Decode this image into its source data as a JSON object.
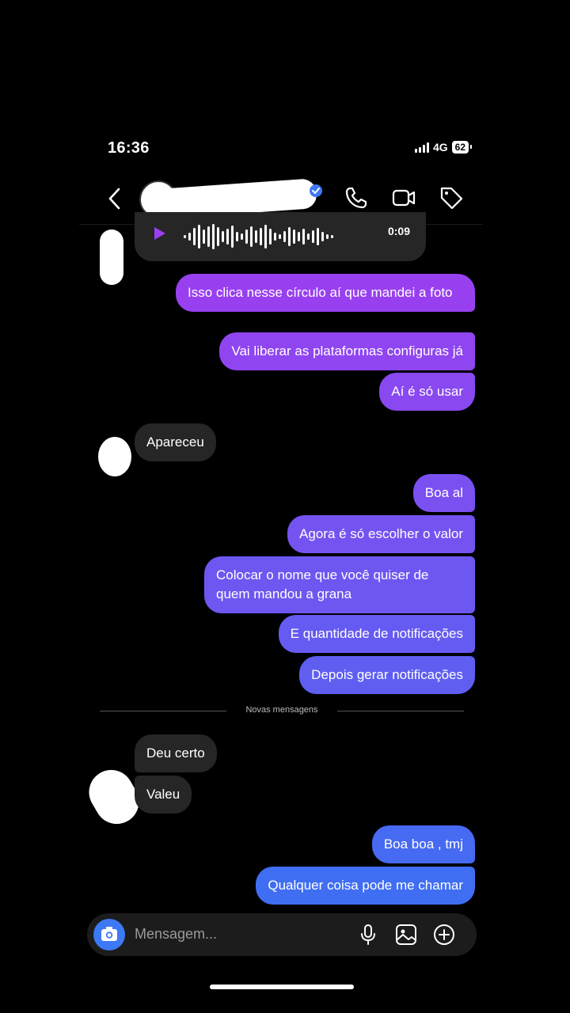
{
  "status_bar": {
    "time": "16:36",
    "network": "4G",
    "battery": "62"
  },
  "composer": {
    "placeholder": "Mensagem..."
  },
  "voice_message": {
    "duration": "0:09"
  },
  "messages": [
    {
      "dir": "out",
      "text": "Isso clica nesse círculo aí que mandei a foto"
    },
    {
      "dir": "out",
      "text": "Vai liberar as plataformas configuras já"
    },
    {
      "dir": "out",
      "text": "Aí é só usar"
    },
    {
      "dir": "in",
      "text": "Apareceu"
    },
    {
      "dir": "out",
      "text": "Boa al"
    },
    {
      "dir": "out",
      "text": "Agora é só escolher o valor"
    },
    {
      "dir": "out",
      "text": "Colocar o nome que você quiser de quem mandou a grana"
    },
    {
      "dir": "out",
      "text": "E quantidade de notificações"
    },
    {
      "dir": "out",
      "text": "Depois gerar notificações"
    },
    {
      "dir": "in",
      "text": "Deu certo"
    },
    {
      "dir": "in",
      "text": "Valeu"
    },
    {
      "dir": "out",
      "text": "Boa boa , tmj"
    },
    {
      "dir": "out",
      "text": "Qualquer coisa pode me chamar"
    }
  ],
  "divider": {
    "label": "Novas mensagens"
  },
  "colors": {
    "bubble_out_top": "#9b3ff0",
    "bubble_out_bottom": "#3d6ff2",
    "bubble_in": "#262626",
    "accent_blue": "#3d79f5"
  },
  "icons": [
    "back-icon",
    "verified-icon",
    "phone-icon",
    "video-icon",
    "tag-icon",
    "play-icon",
    "camera-icon",
    "microphone-icon",
    "gallery-icon",
    "plus-icon"
  ]
}
